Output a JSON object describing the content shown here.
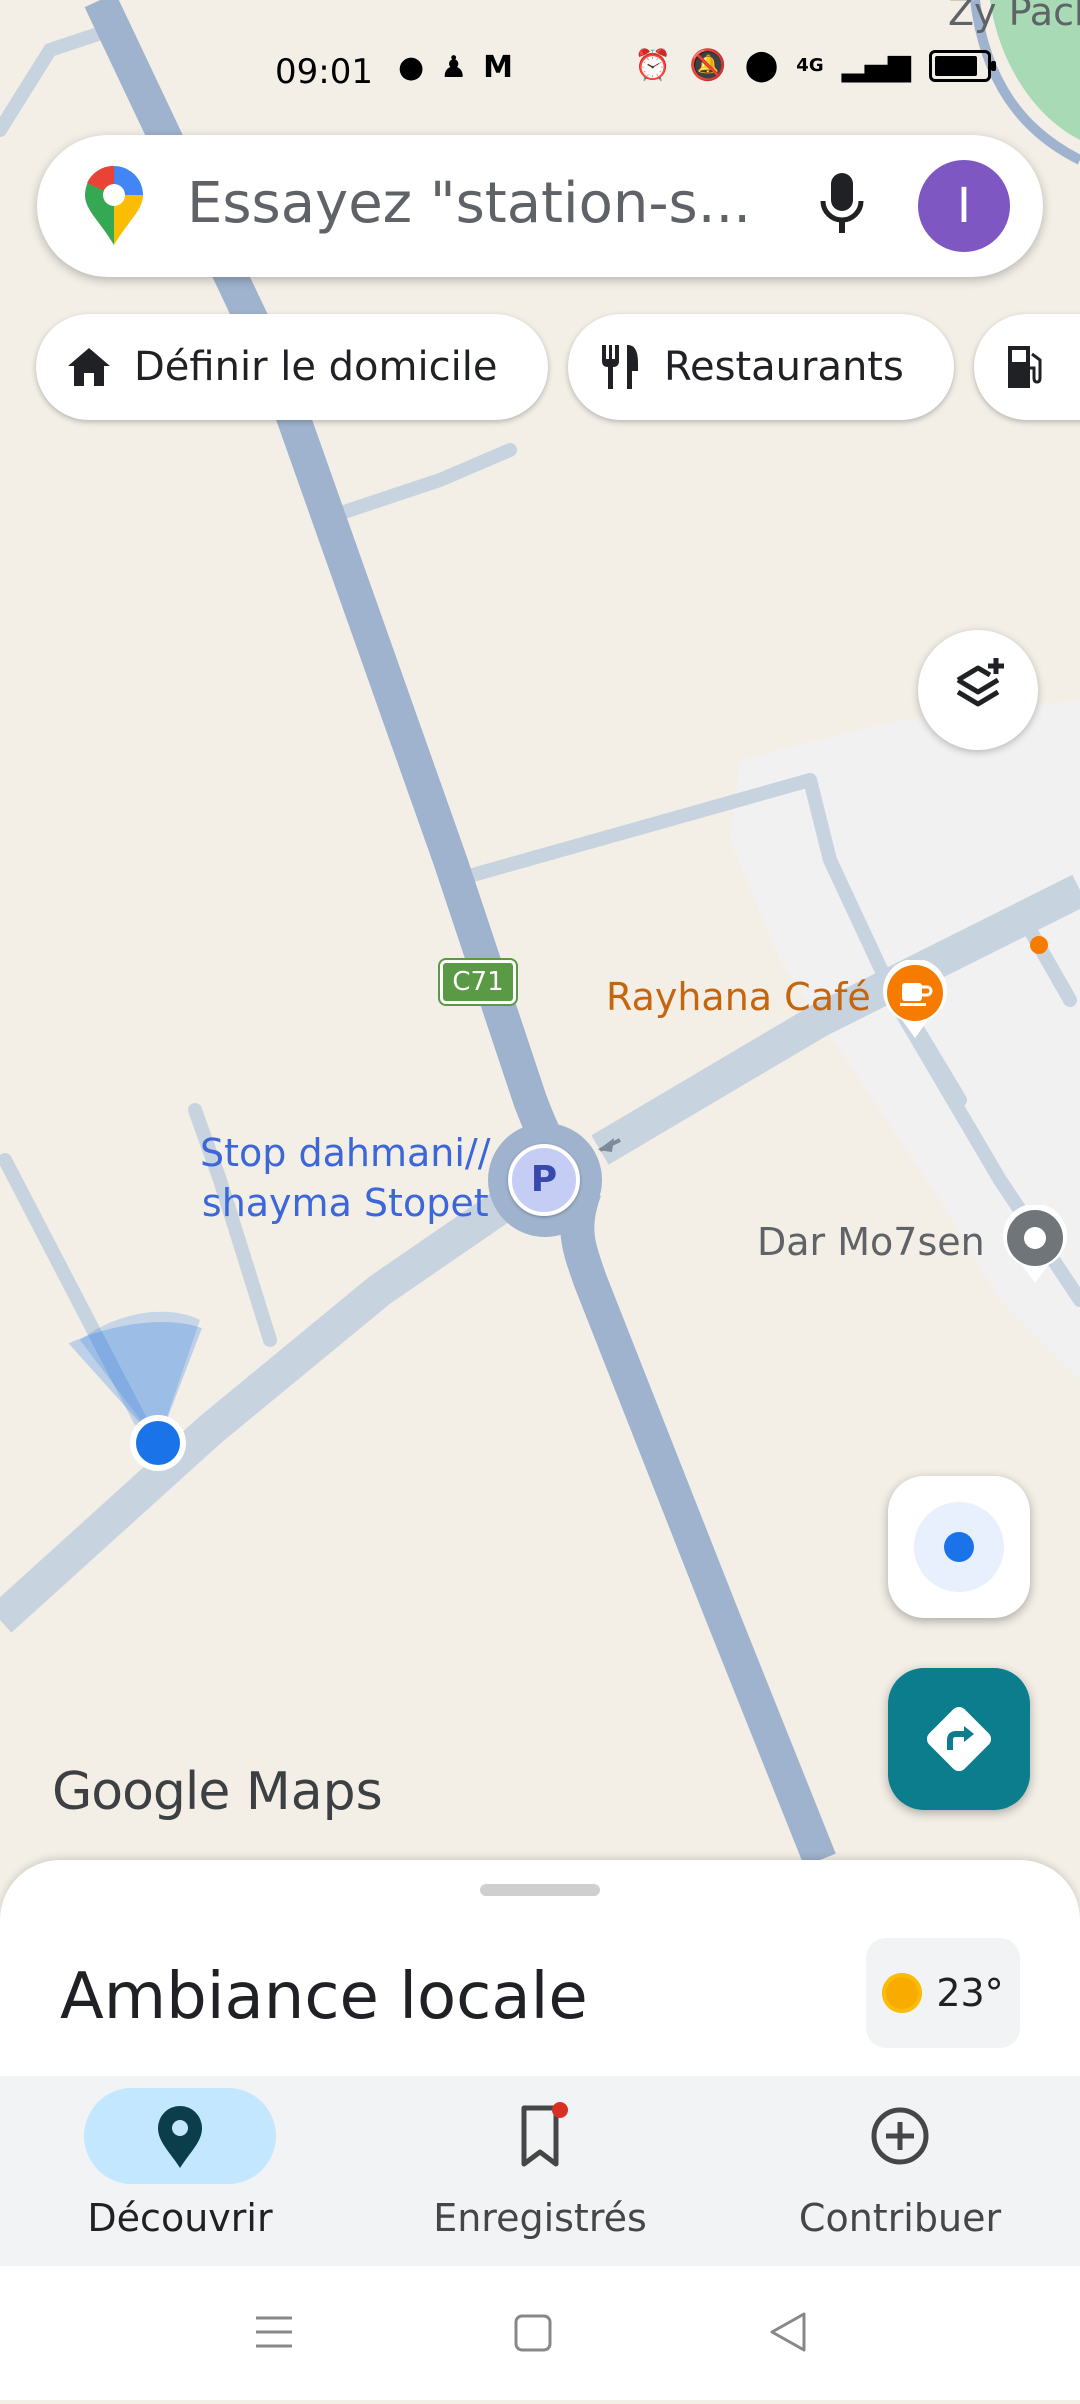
{
  "status_bar": {
    "time": "09:01",
    "left_icons": [
      "chat-bubble-icon",
      "snapchat-icon",
      "gmail-icon"
    ],
    "right_icons": [
      "alarm-icon",
      "mute-icon",
      "location-icon",
      "4g-icon",
      "signal-icon",
      "battery-icon"
    ],
    "network_label": "4G"
  },
  "search": {
    "placeholder": "Essayez \"station-s...",
    "avatar_initial": "I"
  },
  "chips": [
    {
      "label": "Définir le domicile",
      "icon": "home-icon"
    },
    {
      "label": "Restaurants",
      "icon": "restaurant-icon"
    },
    {
      "label": "",
      "icon": "gas-station-icon"
    }
  ],
  "map": {
    "road_badge": "C71",
    "places": [
      {
        "name": "Rayhana Café",
        "icon": "coffee-icon",
        "color": "#c5660e"
      },
      {
        "name": "Stop dahmani//",
        "name_line2": "shayma Stopet",
        "icon": "parking-icon",
        "color": "#3c67d8"
      },
      {
        "name": "Dar Mo7sen",
        "icon": "place-pin-icon",
        "color": "#5f6368"
      }
    ],
    "corner_label": "Zy Pack",
    "colors": {
      "land": "#f3efe7",
      "main_road": "#9fb3ce",
      "minor_road": "#c8d3e0",
      "park": "#a8dab5",
      "user_dot": "#1a73e8"
    }
  },
  "watermark": {
    "google": "Google",
    "maps": "Maps"
  },
  "sheet": {
    "title": "Ambiance locale",
    "weather_temp": "23°"
  },
  "bottom_nav": [
    {
      "label": "Découvrir",
      "icon": "explore-pin-icon",
      "active": true
    },
    {
      "label": "Enregistrés",
      "icon": "bookmark-icon",
      "active": false
    },
    {
      "label": "Contribuer",
      "icon": "add-circle-icon",
      "active": false
    }
  ]
}
